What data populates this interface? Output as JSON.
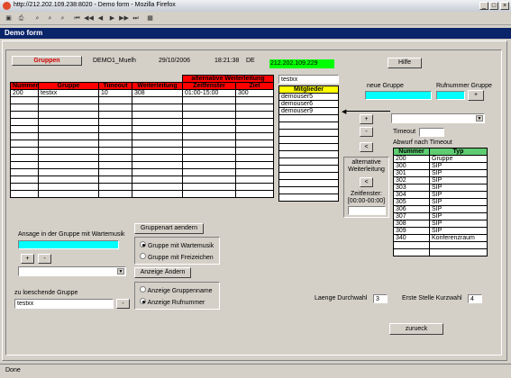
{
  "window": {
    "title": "http://212.202.109.238:8020 - Demo form - Mozilla Firefox"
  },
  "app": {
    "title": "Demo form"
  },
  "header": {
    "group_button": "Gruppen",
    "user": "DEMO1_Muelh",
    "date": "29/10/2006",
    "time": "18:21:38",
    "lang": "DE",
    "ip": "212.202.109.229",
    "help_button": "Hilfe"
  },
  "group_table": {
    "super_header": "alternative Weiterleitung",
    "columns": [
      "Nummer",
      "Gruppe",
      "Timeout",
      "Weiterleitung",
      "Zeitfenster",
      "Ziel"
    ],
    "rows": [
      [
        "200",
        "testxx",
        "10",
        "308",
        "01:00-15:00",
        "300"
      ]
    ],
    "empty_rows": 14
  },
  "members": {
    "filter_value": "testxx",
    "header": "Mitglieder",
    "items": [
      "demouser5",
      "demouser6",
      "demouser9"
    ],
    "empty_rows": 12
  },
  "move": {
    "add": "+",
    "remove": "-",
    "left": "<"
  },
  "new_group": {
    "label": "neue Gruppe",
    "number_label": "Rufnummer Gruppe",
    "add": "+",
    "timeout_label": "Timeout",
    "abwurf_label": "Abwurf nach Timeout"
  },
  "alt_forward": {
    "label": "alternative Weiterleitung",
    "left": "<",
    "window_label": "Zeitfenster:",
    "window_value": "[00:00-00:00]"
  },
  "number_table": {
    "columns": [
      "Nummer",
      "Typ"
    ],
    "rows": [
      [
        "200",
        "Gruppe"
      ],
      [
        "300",
        "SIP"
      ],
      [
        "301",
        "SIP"
      ],
      [
        "302",
        "SIP"
      ],
      [
        "303",
        "SIP"
      ],
      [
        "304",
        "SIP"
      ],
      [
        "305",
        "SIP"
      ],
      [
        "306",
        "SIP"
      ],
      [
        "307",
        "SIP"
      ],
      [
        "308",
        "SIP"
      ],
      [
        "309",
        "SIP"
      ],
      [
        "340",
        "Konferenzraum"
      ]
    ],
    "empty_rows": 2
  },
  "announce": {
    "label": "Ansage in der Gruppe mit Wartemusik",
    "add": "+",
    "remove": "-"
  },
  "group_type": {
    "button": "Gruppenart aendern",
    "options": [
      "Gruppe mit Wartemusik",
      "Gruppe mit Freizeichen"
    ],
    "selected": 0
  },
  "display": {
    "button": "Anzeige Ändern",
    "options": [
      "Anzeige Gruppenname",
      "Anzeige Rufnummer"
    ],
    "selected": 1
  },
  "delete": {
    "label": "zu loeschende Gruppe",
    "value": "testxx",
    "remove": "-"
  },
  "settings": {
    "dial_length_label": "Laenge Durchwahl",
    "dial_length_value": "3",
    "first_digit_label": "Erste Stelle Kurzwahl",
    "first_digit_value": "4"
  },
  "back_button": "zurueck",
  "status": "Done"
}
